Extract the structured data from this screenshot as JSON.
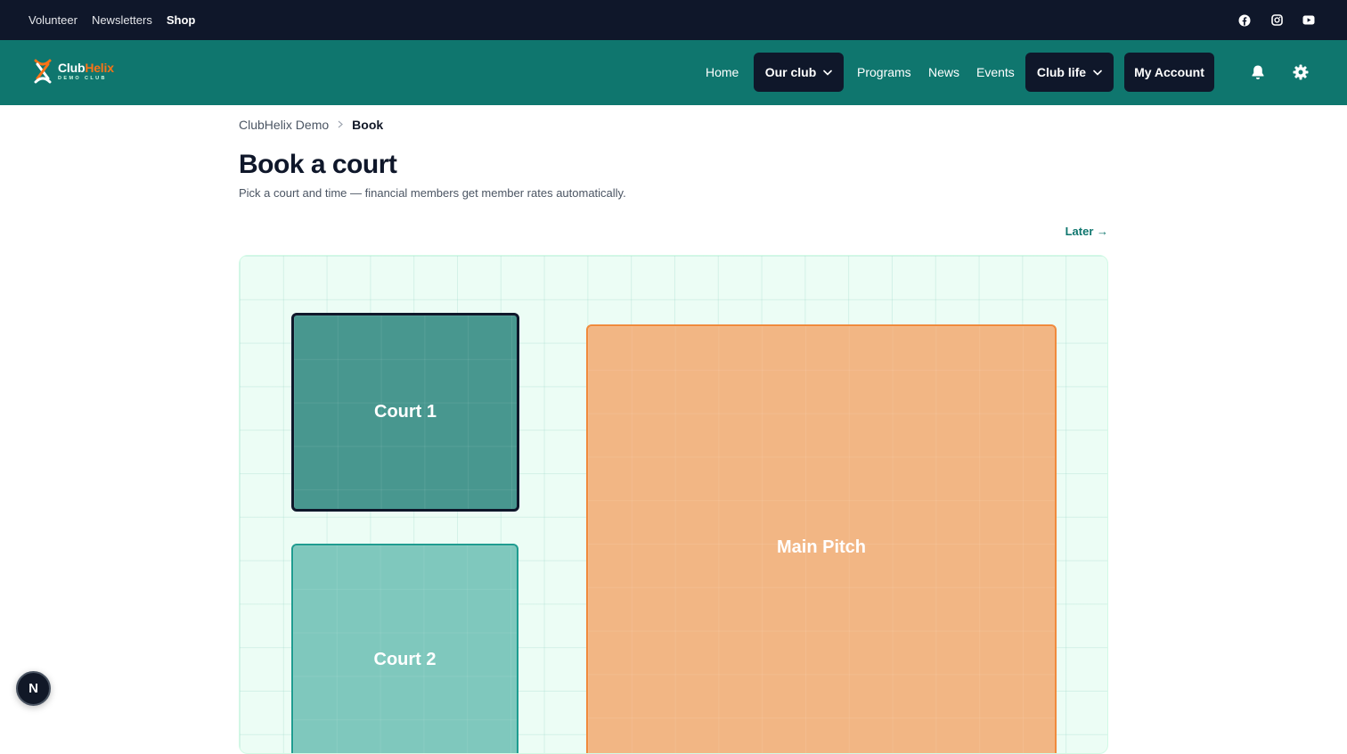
{
  "utility_bar": {
    "links": [
      "Volunteer",
      "Newsletters",
      "Shop"
    ],
    "social_icons": [
      "facebook-icon",
      "instagram-icon",
      "youtube-icon"
    ]
  },
  "brand": {
    "name_part1": "Club",
    "name_part2": "Helix",
    "tagline": "DEMO CLUB",
    "colors": {
      "nav": "#0f766e",
      "dark": "#0f172a",
      "accent": "#f97316"
    }
  },
  "nav": {
    "home": "Home",
    "our_club": "Our club",
    "programs": "Programs",
    "news": "News",
    "events": "Events",
    "club_life": "Club life",
    "my_account": "My Account"
  },
  "breadcrumb": {
    "parent": "ClubHelix Demo",
    "current": "Book"
  },
  "page": {
    "title": "Book a court",
    "subtitle": "Pick a court and time — financial members get member rates automatically.",
    "later_link": "Later →"
  },
  "map": {
    "courts": [
      {
        "name": "Court 1",
        "selected": true,
        "color": "#48978f"
      },
      {
        "name": "Court 2",
        "selected": false,
        "color": "#7fc8bd"
      },
      {
        "name": "Main Pitch",
        "selected": false,
        "color": "#f2b684"
      }
    ]
  },
  "dev_badge": "N"
}
